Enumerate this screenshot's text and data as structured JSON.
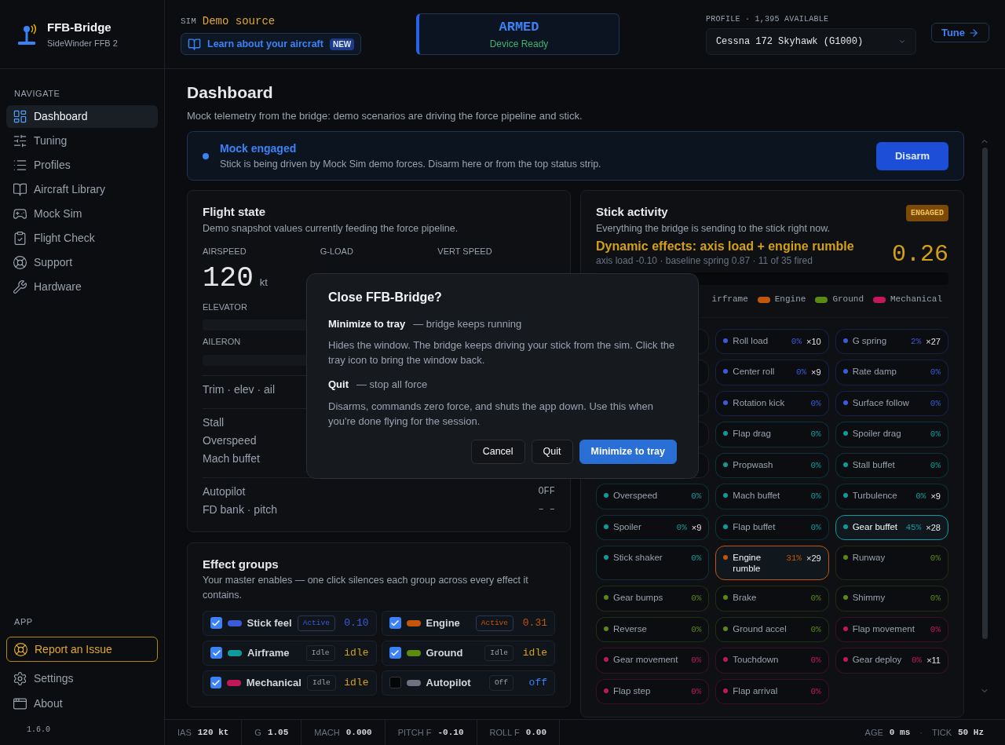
{
  "app": {
    "name": "FFB-Bridge",
    "device": "SideWinder FFB 2",
    "version": "1.6.0"
  },
  "sidebar": {
    "nav_label": "NAVIGATE",
    "items": [
      {
        "label": "Dashboard",
        "selected": true
      },
      {
        "label": "Tuning",
        "selected": false
      },
      {
        "label": "Profiles",
        "selected": false
      },
      {
        "label": "Aircraft Library",
        "selected": false
      },
      {
        "label": "Mock Sim",
        "selected": false
      },
      {
        "label": "Flight Check",
        "selected": false
      },
      {
        "label": "Support",
        "selected": false
      },
      {
        "label": "Hardware",
        "selected": false
      }
    ],
    "app_label": "APP",
    "report": "Report an Issue",
    "app_items": [
      {
        "label": "Settings"
      },
      {
        "label": "About"
      }
    ]
  },
  "topbar": {
    "sim_label": "SIM",
    "sim_source": "Demo source",
    "learn": "Learn about your aircraft",
    "learn_badge": "NEW",
    "status": "ARMED",
    "status_sub": "Device Ready",
    "profile_label": "PROFILE · 1,395 AVAILABLE",
    "profile": "Cessna 172 Skyhawk (G1000)",
    "tune": "Tune"
  },
  "page": {
    "title": "Dashboard",
    "subtitle": "Mock telemetry from the bridge: demo scenarios are driving the force pipeline and stick."
  },
  "banner": {
    "title": "Mock engaged",
    "text": "Stick is being driven by Mock Sim demo forces. Disarm here or from the top status strip.",
    "button": "Disarm"
  },
  "flight_state": {
    "title": "Flight state",
    "subtitle": "Demo snapshot values currently feeding the force pipeline.",
    "stats": [
      {
        "label": "AIRSPEED",
        "value": "120",
        "unit": "kt"
      },
      {
        "label": "G-LOAD"
      },
      {
        "label": "VERT SPEED"
      }
    ],
    "bars": [
      {
        "label": "ELEVATOR"
      },
      {
        "label": "AILERON"
      }
    ],
    "row_groups": [
      [
        {
          "label": "Trim · elev · ail"
        }
      ],
      [
        {
          "label": "Stall"
        },
        {
          "label": "Overspeed"
        },
        {
          "label": "Mach buffet"
        }
      ],
      [
        {
          "label": "Autopilot",
          "value": "OFF"
        },
        {
          "label": "FD bank · pitch",
          "value": "– –"
        }
      ]
    ]
  },
  "effect_groups": {
    "title": "Effect groups",
    "subtitle": "Your master enables — one click silences each group across every effect it contains.",
    "items": [
      {
        "name": "Stick feel",
        "checked": true,
        "color": "#3b5bdb",
        "kind": "active",
        "status": "Active",
        "value": "0.10"
      },
      {
        "name": "Engine",
        "checked": true,
        "color": "#c2570c",
        "kind": "active",
        "status": "Active",
        "value": "0.31"
      },
      {
        "name": "Airframe",
        "checked": true,
        "color": "#0f9b9b",
        "kind": "idle",
        "status": "Idle",
        "value": "idle"
      },
      {
        "name": "Ground",
        "checked": true,
        "color": "#5b8a12",
        "kind": "idle",
        "status": "Idle",
        "value": "idle"
      },
      {
        "name": "Mechanical",
        "checked": true,
        "color": "#c2185b",
        "kind": "idle",
        "status": "Idle",
        "value": "idle"
      },
      {
        "name": "Autopilot",
        "checked": false,
        "color": "#6b7280",
        "kind": "off",
        "status": "Off",
        "value": "off"
      }
    ]
  },
  "stick_activity": {
    "title": "Stick activity",
    "subtitle": "Everything the bridge is sending to the stick right now.",
    "badge": "ENGAGED",
    "headline": "Dynamic effects: axis load + engine rumble",
    "detail": "axis load -0.10 · baseline spring 0.87 · 11 of 35 fired",
    "value": "0.26",
    "legend": [
      {
        "label": "irframe"
      },
      {
        "label": "Engine",
        "color": "#c2570c"
      },
      {
        "label": "Ground",
        "color": "#5b8a12"
      },
      {
        "label": "Mechanical",
        "color": "#c2185b"
      }
    ],
    "chips": [
      {
        "active": false
      },
      {
        "label": "Roll load",
        "pct": "0%",
        "count": "×10",
        "color": "#3b5bdb",
        "active": false
      },
      {
        "label": "G spring",
        "pct": "2%",
        "count": "×27",
        "color": "#3b5bdb",
        "active": false
      },
      {
        "active": false
      },
      {
        "label": "Center roll",
        "pct": "0%",
        "count": "×9",
        "color": "#3b5bdb",
        "active": false
      },
      {
        "label": "Rate damp",
        "pct": "0%",
        "color": "#3b5bdb",
        "active": false
      },
      {
        "active": false
      },
      {
        "label": "Rotation kick",
        "pct": "0%",
        "color": "#3b5bdb",
        "active": false
      },
      {
        "label": "Surface follow",
        "pct": "0%",
        "color": "#3b5bdb",
        "active": false
      },
      {
        "active": false
      },
      {
        "label": "Flap drag",
        "pct": "0%",
        "color": "#0f9b9b",
        "active": false
      },
      {
        "label": "Spoiler drag",
        "pct": "0%",
        "color": "#0f9b9b",
        "active": false
      },
      {
        "active": false
      },
      {
        "label": "Propwash",
        "pct": "0%",
        "color": "#0f9b9b",
        "active": false
      },
      {
        "label": "Stall buffet",
        "pct": "0%",
        "color": "#0f9b9b",
        "active": false
      },
      {
        "label": "Overspeed",
        "pct": "0%",
        "color": "#0f9b9b",
        "active": false
      },
      {
        "label": "Mach buffet",
        "pct": "0%",
        "color": "#0f9b9b",
        "active": false
      },
      {
        "label": "Turbulence",
        "pct": "0%",
        "count": "×9",
        "color": "#0f9b9b",
        "active": false
      },
      {
        "label": "Spoiler",
        "pct": "0%",
        "count": "×9",
        "color": "#0f9b9b",
        "active": false
      },
      {
        "label": "Flap buffet",
        "pct": "0%",
        "color": "#0f9b9b",
        "active": false
      },
      {
        "label": "Gear buffet",
        "pct": "45%",
        "count": "×28",
        "color": "#0f9b9b",
        "active": true
      },
      {
        "label": "Stick shaker",
        "pct": "0%",
        "color": "#0f9b9b",
        "active": false
      },
      {
        "label": "Engine rumble",
        "pct": "31%",
        "count": "×29",
        "color": "#c2570c",
        "active": true
      },
      {
        "label": "Runway",
        "pct": "0%",
        "color": "#5b8a12",
        "active": false
      },
      {
        "label": "Gear bumps",
        "pct": "0%",
        "color": "#5b8a12",
        "active": false
      },
      {
        "label": "Brake",
        "pct": "0%",
        "color": "#5b8a12",
        "active": false
      },
      {
        "label": "Shimmy",
        "pct": "0%",
        "color": "#5b8a12",
        "active": false
      },
      {
        "label": "Reverse",
        "pct": "0%",
        "color": "#5b8a12",
        "active": false
      },
      {
        "label": "Ground accel",
        "pct": "0%",
        "color": "#5b8a12",
        "active": false
      },
      {
        "label": "Flap movement",
        "pct": "0%",
        "color": "#c2185b",
        "active": false
      },
      {
        "label": "Gear movement",
        "pct": "0%",
        "color": "#c2185b",
        "active": false
      },
      {
        "label": "Touchdown",
        "pct": "0%",
        "color": "#c2185b",
        "active": false
      },
      {
        "label": "Gear deploy",
        "pct": "0%",
        "count": "×11",
        "color": "#c2185b",
        "active": false
      },
      {
        "label": "Flap step",
        "pct": "0%",
        "color": "#c2185b",
        "active": false
      },
      {
        "label": "Flap arrival",
        "pct": "0%",
        "color": "#c2185b",
        "active": false
      }
    ]
  },
  "status_bar": {
    "left": [
      {
        "label": "IAS",
        "value": "120 kt"
      },
      {
        "label": "G",
        "value": "1.05"
      },
      {
        "label": "MACH",
        "value": "0.000"
      },
      {
        "label": "PITCH F",
        "value": "-0.10"
      },
      {
        "label": "ROLL F",
        "value": "0.00"
      }
    ],
    "right": [
      {
        "label": "AGE",
        "value": "0 ms"
      },
      {
        "separator": "·"
      },
      {
        "label": "TICK",
        "value": "50 Hz"
      }
    ]
  },
  "dialog": {
    "title": "Close FFB-Bridge?",
    "sections": [
      {
        "heading": "Minimize to tray",
        "note": "— bridge keeps running",
        "body": "Hides the window. The bridge keeps driving your stick from the sim. Click the tray icon to bring the window back."
      },
      {
        "heading": "Quit",
        "note": "— stop all force",
        "body": "Disarms, commands zero force, and shuts the app down. Use this when you're done flying for the session."
      }
    ],
    "buttons": [
      {
        "label": "Cancel",
        "kind": "secondary"
      },
      {
        "label": "Quit",
        "kind": "secondary"
      },
      {
        "label": "Minimize to tray",
        "kind": "primary"
      }
    ]
  }
}
